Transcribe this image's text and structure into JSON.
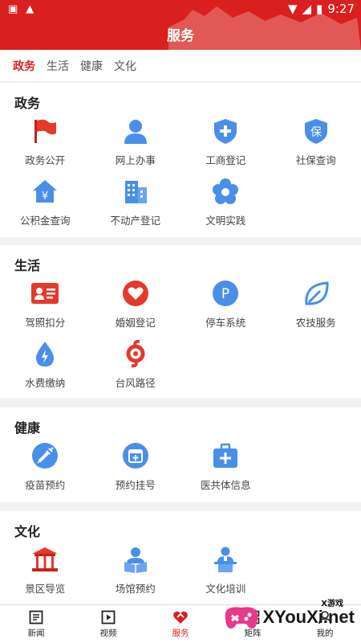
{
  "status": {
    "time": "9:27"
  },
  "header": {
    "title": "服务"
  },
  "tabs": [
    {
      "label": "政务",
      "active": true
    },
    {
      "label": "生活"
    },
    {
      "label": "健康"
    },
    {
      "label": "文化"
    }
  ],
  "sections": [
    {
      "title": "政务",
      "items": [
        {
          "label": "政务公开",
          "icon": "red-flag-icon"
        },
        {
          "label": "网上办事",
          "icon": "person-icon"
        },
        {
          "label": "工商登记",
          "icon": "shield-plus-icon"
        },
        {
          "label": "社保查询",
          "icon": "shield-bao-icon"
        },
        {
          "label": "公积金查询",
          "icon": "house-yuan-icon"
        },
        {
          "label": "不动产登记",
          "icon": "building-icon"
        },
        {
          "label": "文明实践",
          "icon": "flower-icon"
        }
      ]
    },
    {
      "title": "生活",
      "items": [
        {
          "label": "驾照扣分",
          "icon": "id-card-icon"
        },
        {
          "label": "婚姻登记",
          "icon": "heart-icon"
        },
        {
          "label": "停车系统",
          "icon": "parking-icon"
        },
        {
          "label": "农技服务",
          "icon": "leaf-icon"
        },
        {
          "label": "水费缴纳",
          "icon": "water-drop-icon"
        },
        {
          "label": "台风路径",
          "icon": "typhoon-icon"
        }
      ]
    },
    {
      "title": "健康",
      "items": [
        {
          "label": "疫苗预约",
          "icon": "syringe-icon"
        },
        {
          "label": "预约挂号",
          "icon": "calendar-plus-icon"
        },
        {
          "label": "医共体信息",
          "icon": "medical-kit-icon"
        }
      ]
    },
    {
      "title": "文化",
      "items": [
        {
          "label": "景区导览",
          "icon": "temple-icon"
        },
        {
          "label": "场馆预约",
          "icon": "reader-icon"
        },
        {
          "label": "文化培训",
          "icon": "lecturer-icon"
        }
      ]
    }
  ],
  "bottom_nav": [
    {
      "label": "新闻",
      "icon": "news-icon"
    },
    {
      "label": "视频",
      "icon": "video-icon"
    },
    {
      "label": "服务",
      "icon": "service-icon",
      "active": true
    },
    {
      "label": "矩阵",
      "icon": "matrix-icon"
    },
    {
      "label": "我的",
      "icon": "profile-icon"
    }
  ],
  "watermark": {
    "text": "XYouXi.net",
    "small": "X游戏"
  },
  "colors": {
    "brand_red": "#d9201f",
    "icon_blue": "#4a8fe7"
  }
}
